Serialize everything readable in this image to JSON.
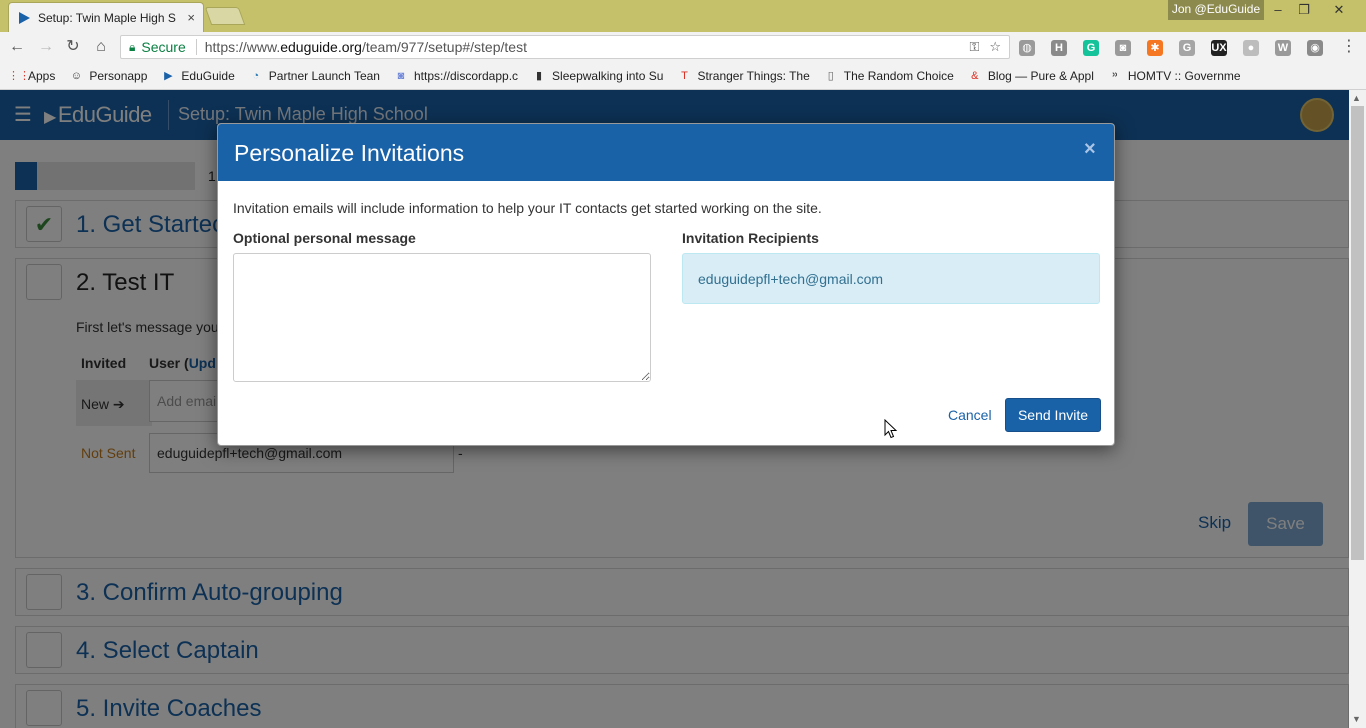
{
  "browser": {
    "tab_title": "Setup: Twin Maple High S",
    "tab_close": "×",
    "profile_name": "Jon @EduGuide",
    "window_controls": {
      "minimize": "–",
      "restore": "❐",
      "close": "✕"
    },
    "nav": {
      "back": "←",
      "forward": "→",
      "reload": "↻",
      "home": "⌂"
    },
    "secure_label": "Secure",
    "url_prefix": "https://www.",
    "url_domain": "eduguide.org",
    "url_path": "/team/977/setup#/step/test",
    "key_icon": "⚿",
    "star_icon": "☆",
    "menu_icon": "⋮",
    "extensions": [
      {
        "name": "globe-extension-icon",
        "glyph": "◍",
        "color": "#9a9a9a"
      },
      {
        "name": "h-extension-icon",
        "glyph": "H",
        "color": "#8a8a8a"
      },
      {
        "name": "grammarly-extension-icon",
        "glyph": "G",
        "color": "#15c39a"
      },
      {
        "name": "camera-extension-icon",
        "glyph": "◙",
        "color": "#9a9a9a"
      },
      {
        "name": "hubspot-extension-icon",
        "glyph": "✱",
        "color": "#f57722"
      },
      {
        "name": "g-extension-icon",
        "glyph": "G",
        "color": "#a5a5a5"
      },
      {
        "name": "ux-extension-icon",
        "glyph": "UX",
        "color": "#222222"
      },
      {
        "name": "circle-extension-icon",
        "glyph": "●",
        "color": "#bdbdbd"
      },
      {
        "name": "w-extension-icon",
        "glyph": "W",
        "color": "#9a9a9a"
      },
      {
        "name": "eye-extension-icon",
        "glyph": "◉",
        "color": "#8a8a8a"
      }
    ],
    "bookmarks": [
      {
        "label": "Apps",
        "icon": "⋮⋮",
        "color": "#d93025"
      },
      {
        "label": "Personapp",
        "icon": "☺",
        "color": "#333333"
      },
      {
        "label": "EduGuide",
        "icon": "▶",
        "color": "#1a62a8"
      },
      {
        "label": "Partner Launch Tean",
        "icon": "◔",
        "color": "#2a7ab8"
      },
      {
        "label": "https://discordapp.c",
        "icon": "◙",
        "color": "#7289da"
      },
      {
        "label": "Sleepwalking into Su",
        "icon": "▮",
        "color": "#333333"
      },
      {
        "label": "Stranger Things: The",
        "icon": "T",
        "color": "#d93025"
      },
      {
        "label": "The Random Choice",
        "icon": "▯",
        "color": "#666666"
      },
      {
        "label": "Blog — Pure & Appl",
        "icon": "&",
        "color": "#d93025"
      },
      {
        "label": "HOMTV :: Governme",
        "icon": "᠉",
        "color": "#333333"
      }
    ]
  },
  "app": {
    "menu_icon": "☰",
    "logo_text": "EduGuide",
    "header_title": "Setup: Twin Maple High School",
    "progress_label": "1",
    "progress_fraction": 0.12,
    "steps": [
      {
        "title": "1. Get Startec",
        "checked": true
      },
      {
        "title": "2. Test IT",
        "checked": false
      },
      {
        "title": "3. Confirm Auto-grouping",
        "checked": false
      },
      {
        "title": "4. Select Captain",
        "checked": false
      },
      {
        "title": "5. Invite Coaches",
        "checked": false
      }
    ],
    "step_check_glyph": "✔",
    "test_it": {
      "intro": "First let's message you",
      "col_invited": "Invited",
      "col_user": "User (",
      "col_user_link": "Upd",
      "new_label": "New",
      "new_icon": "➔",
      "add_email_placeholder": "Add email",
      "status_not_sent": "Not Sent",
      "recipient_email": "eduguidepfl+tech@gmail.com",
      "dash": "-",
      "skip_label": "Skip",
      "save_label": "Save"
    }
  },
  "modal": {
    "title": "Personalize Invitations",
    "close": "×",
    "intro": "Invitation emails will include information to help your IT contacts get started working on the site.",
    "message_label": "Optional personal message",
    "message_value": "",
    "recipients_label": "Invitation Recipients",
    "recipients": [
      "eduguidepfl+tech@gmail.com"
    ],
    "cancel_label": "Cancel",
    "send_label": "Send Invite"
  }
}
